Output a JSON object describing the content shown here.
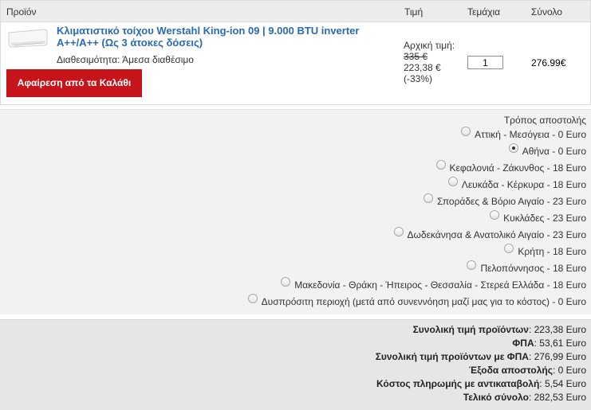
{
  "table": {
    "headers": {
      "product": "Προϊόν",
      "price": "Τιμή",
      "quantity": "Τεμάχια",
      "total": "Σύνολο"
    }
  },
  "item": {
    "title": "Κλιματιστικό τοίχου Werstahl King-ion 09 | 9.000 BTU inverter A++/A++ (Ως 3 άτοκες δόσεις)",
    "availability_label": "Διαθεσιμότητα:",
    "availability_value": "Άμεσα διαθέσιμο",
    "remove_label": "Αφαίρεση από τα Καλάθι",
    "original_price_label": "Αρχική τιμή:",
    "original_price": "335 €",
    "price": "223,38 €",
    "discount": "(-33%)",
    "quantity": "1",
    "line_total": "276.99€"
  },
  "shipping": {
    "title": "Τρόπος αποστολής",
    "options": [
      {
        "label": "Αττική - Μεσόγεια - 0 Euro",
        "checked": false
      },
      {
        "label": "Αθήνα - 0 Euro",
        "checked": true
      },
      {
        "label": "Κεφαλονιά - Ζάκυνθος - 18 Euro",
        "checked": false
      },
      {
        "label": "Λευκάδα - Κέρκυρα - 18 Euro",
        "checked": false
      },
      {
        "label": "Σποράδες & Βόριο Αιγαίο - 23 Euro",
        "checked": false
      },
      {
        "label": "Κυκλάδες - 23 Euro",
        "checked": false
      },
      {
        "label": "Δωδεκάνησα & Ανατολικό Αιγαίο - 23 Euro",
        "checked": false
      },
      {
        "label": "Κρήτη - 18 Euro",
        "checked": false
      },
      {
        "label": "Πελοπόννησος - 18 Euro",
        "checked": false
      },
      {
        "label": "Μακεδονία - Θράκη - Ήπειρος - Θεσσαλία - Στερεά Ελλάδα - 18 Euro",
        "checked": false
      },
      {
        "label": "Δυσπρόσιτη περιοχή (μετά από συνεννόηση μαζί μας για το κόστος) - 0 Euro",
        "checked": false
      }
    ]
  },
  "totals": {
    "rows": [
      {
        "label": "Συνολική τιμή προϊόντων",
        "value": ": 223,38 Euro"
      },
      {
        "label": "ΦΠΑ",
        "value": ": 53,61 Euro"
      },
      {
        "label": "Συνολική τιμή προϊόντων με ΦΠΑ",
        "value": ": 276,99 Euro"
      },
      {
        "label": "Έξοδα αποστολής",
        "value": ": 0 Euro"
      },
      {
        "label": "Κόστος πληρωμής με αντικαταβολή",
        "value": ": 5,54 Euro"
      },
      {
        "label": "Τελικό σύνολο",
        "value": ": 282,53 Euro"
      }
    ]
  },
  "colors": {
    "accent_link": "#2a6ab3",
    "remove_button": "#c6141b",
    "header_bg": "#ececec",
    "shipping_bg": "#f2f2f2",
    "totals_bg": "#e6e6e6"
  },
  "icons": {
    "product_image": "air-conditioner-unit"
  }
}
